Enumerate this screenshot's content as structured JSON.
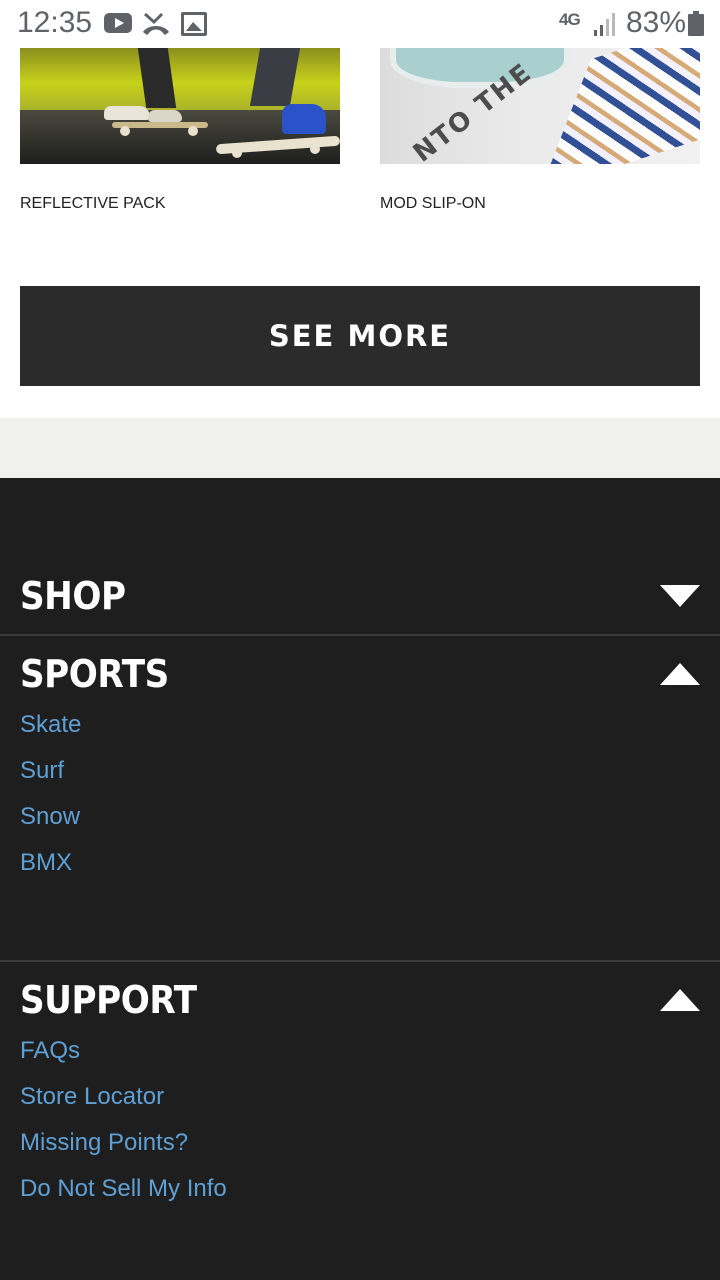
{
  "status_bar": {
    "time": "12:35",
    "network": "4G",
    "battery": "83%",
    "icons": [
      "youtube-icon",
      "missed-call-icon",
      "gallery-icon",
      "lte-icon",
      "signal-icon",
      "battery-icon"
    ]
  },
  "products": [
    {
      "name": "REFLECTIVE PACK"
    },
    {
      "name": "MOD SLIP-ON"
    }
  ],
  "see_more_label": "SEE MORE",
  "footer": {
    "sections": [
      {
        "title": "SHOP",
        "expanded": false,
        "links": []
      },
      {
        "title": "SPORTS",
        "expanded": true,
        "links": [
          "Skate",
          "Surf",
          "Snow",
          "BMX"
        ]
      },
      {
        "title": "SUPPORT",
        "expanded": true,
        "links": [
          "FAQs",
          "Store Locator",
          "Missing Points?",
          "Do Not Sell My Info"
        ]
      }
    ]
  },
  "colors": {
    "footer_bg": "#1e1e1f",
    "link": "#5fa0d4",
    "button_bg": "#2b2b2c",
    "band": "#f0f0ec"
  }
}
